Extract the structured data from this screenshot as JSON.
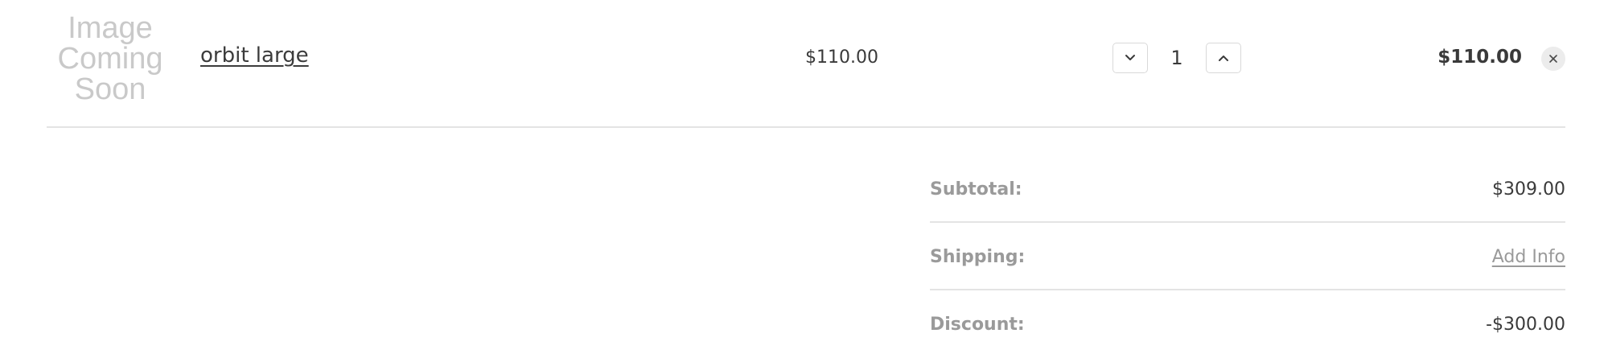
{
  "cart_item": {
    "image_placeholder": [
      "Image",
      "Coming",
      "Soon"
    ],
    "name": "orbit large",
    "unit_price": "$110.00",
    "quantity": "1",
    "line_total": "$110.00",
    "decrease_icon": "chevron-down-icon",
    "increase_icon": "chevron-up-icon",
    "remove_icon": "close-icon"
  },
  "summary": {
    "subtotal_label": "Subtotal:",
    "subtotal_value": "$309.00",
    "shipping_label": "Shipping:",
    "shipping_value": "Add Info",
    "discount_label": "Discount:",
    "discount_value": "-$300.00"
  },
  "colors": {
    "text": "#3a3a3a",
    "muted": "#9a9a9a",
    "placeholder": "#c9c9c9",
    "divider": "#e4e4e4",
    "remove_bg": "#ececec"
  }
}
